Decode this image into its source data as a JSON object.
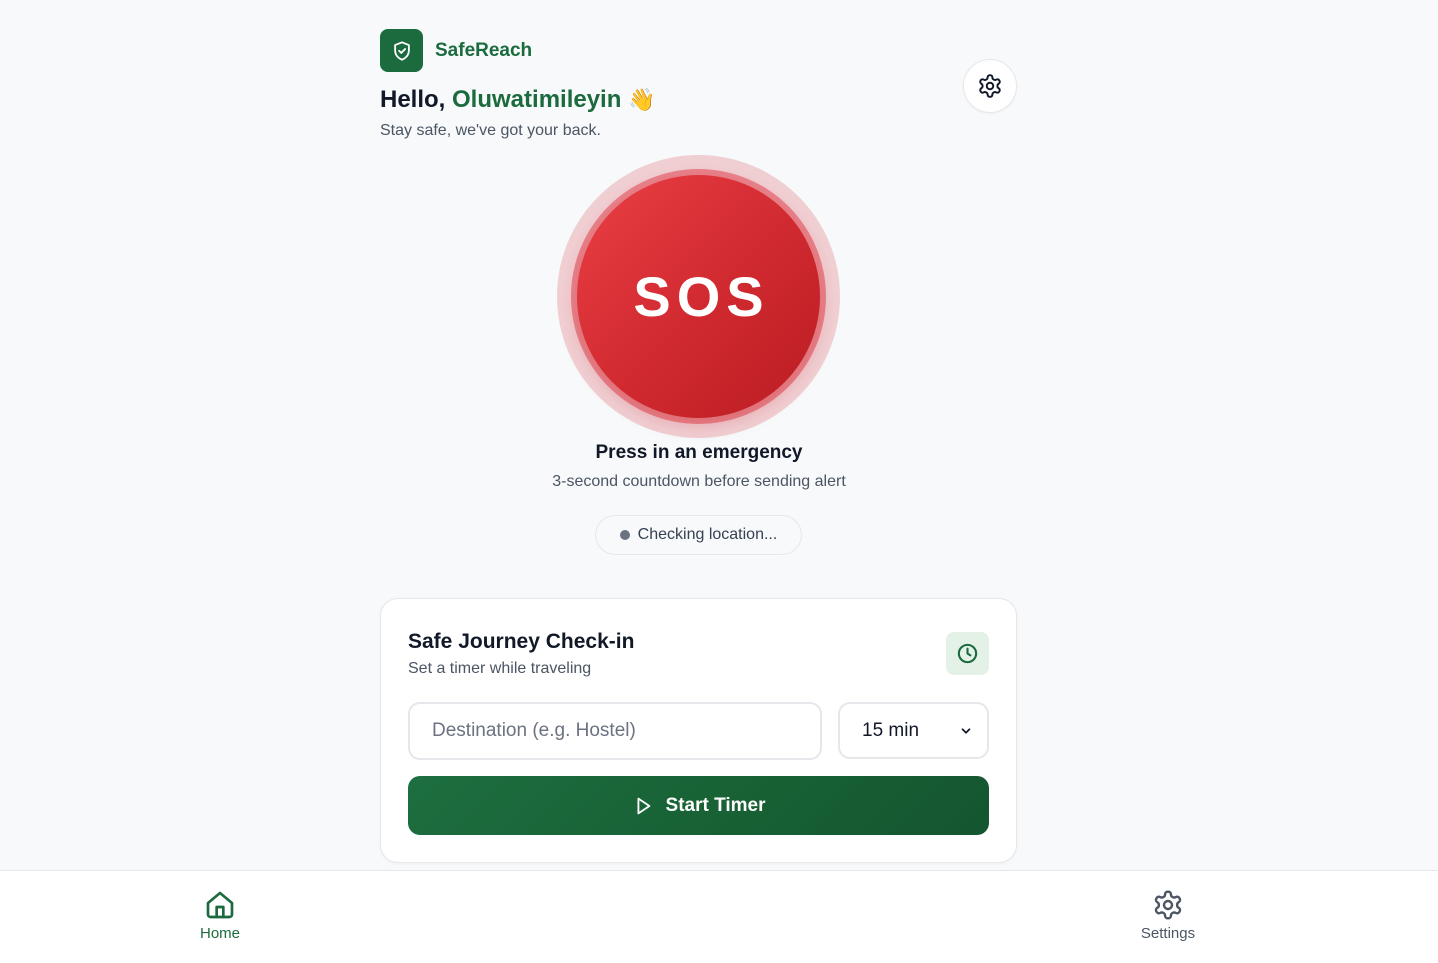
{
  "app": {
    "name": "SafeReach",
    "logo_icon": "shield-check-icon"
  },
  "greeting": {
    "prefix": "Hello, ",
    "name": "Oluwatimileyin",
    "emoji": "👋",
    "subtitle": "Stay safe, we've got your back."
  },
  "header": {
    "settings_icon": "gear-icon"
  },
  "sos": {
    "label": "SOS",
    "title": "Press in an emergency",
    "subtitle": "3-second countdown before sending alert"
  },
  "location": {
    "status": "Checking location..."
  },
  "checkin": {
    "title": "Safe Journey Check-in",
    "subtitle": "Set a timer while traveling",
    "icon": "clock-icon",
    "destination_placeholder": "Destination (e.g. Hostel)",
    "destination_value": "",
    "duration_selected": "15 min",
    "start_label": "Start Timer"
  },
  "nav": {
    "home_label": "Home",
    "settings_label": "Settings"
  },
  "colors": {
    "brand": "#1b6b3e",
    "sos": "#d22b31",
    "text": "#111827",
    "muted": "#4b5563"
  }
}
